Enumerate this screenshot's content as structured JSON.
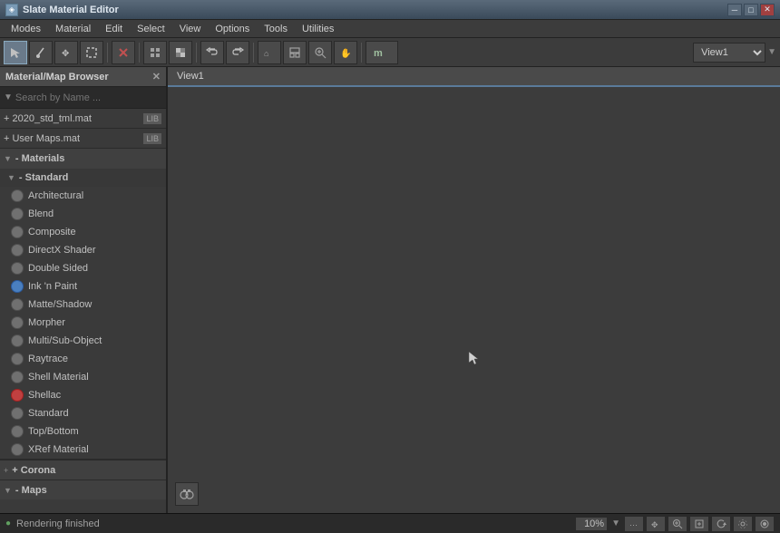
{
  "titlebar": {
    "icon": "◈",
    "title": "Slate Material Editor",
    "min_label": "─",
    "max_label": "□",
    "close_label": "✕"
  },
  "menubar": {
    "items": [
      "Modes",
      "Material",
      "Edit",
      "Select",
      "View",
      "Options",
      "Tools",
      "Utilities"
    ]
  },
  "toolbar": {
    "view_label": "View1"
  },
  "panel": {
    "title": "Material/Map Browser",
    "close_label": "✕",
    "search_placeholder": "Search by Name ...",
    "files": [
      {
        "name": "+ 2020_std_tml.mat",
        "badge": "LIB"
      },
      {
        "name": "+ User Maps.mat",
        "badge": "LIB"
      }
    ]
  },
  "tree": {
    "materials_label": "- Materials",
    "standard_label": "- Standard",
    "items": [
      {
        "label": "Architectural",
        "icon": "gray"
      },
      {
        "label": "Blend",
        "icon": "gray"
      },
      {
        "label": "Composite",
        "icon": "gray"
      },
      {
        "label": "DirectX Shader",
        "icon": "gray"
      },
      {
        "label": "Double Sided",
        "icon": "gray"
      },
      {
        "label": "Ink 'n Paint",
        "icon": "blue"
      },
      {
        "label": "Matte/Shadow",
        "icon": "gray"
      },
      {
        "label": "Morpher",
        "icon": "gray"
      },
      {
        "label": "Multi/Sub-Object",
        "icon": "gray"
      },
      {
        "label": "Raytrace",
        "icon": "gray"
      },
      {
        "label": "Shell Material",
        "icon": "gray"
      },
      {
        "label": "Shellac",
        "icon": "red"
      },
      {
        "label": "Standard",
        "icon": "gray"
      },
      {
        "label": "Top/Bottom",
        "icon": "gray"
      },
      {
        "label": "XRef Material",
        "icon": "gray"
      }
    ],
    "corona_label": "+ Corona",
    "maps_label": "- Maps"
  },
  "viewport": {
    "tab_label": "View1"
  },
  "statusbar": {
    "icon": "●",
    "text": "Rendering finished",
    "zoom": "10%",
    "nav_buttons": [
      "⋯",
      "⌖",
      "⊕",
      "↕",
      "⟳",
      "◈",
      "⊙"
    ]
  }
}
